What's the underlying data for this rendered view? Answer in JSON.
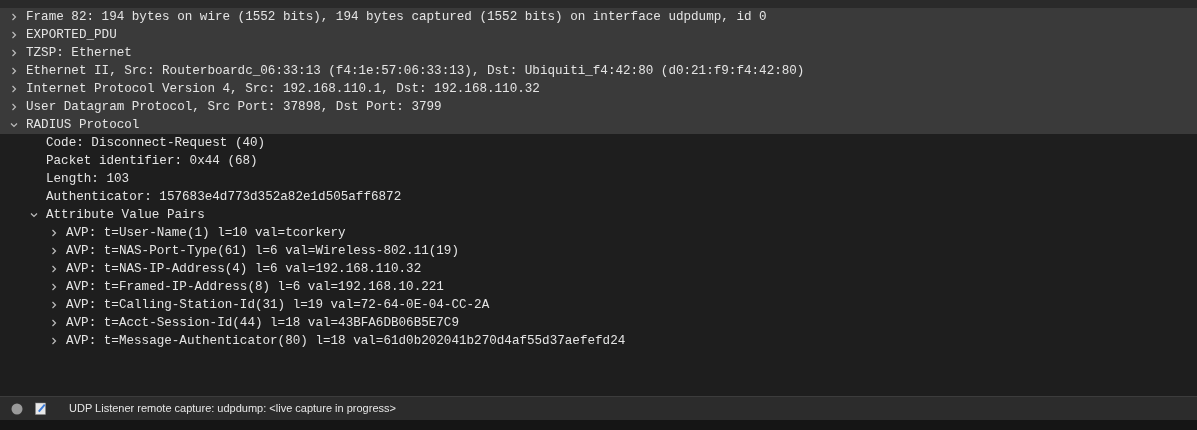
{
  "tree": [
    {
      "text": "Frame 82: 194 bytes on wire (1552 bits), 194 bytes captured (1552 bits) on interface udpdump, id 0",
      "expanded": false
    },
    {
      "text": "EXPORTED_PDU",
      "expanded": false
    },
    {
      "text": "TZSP: Ethernet",
      "expanded": false
    },
    {
      "text": "Ethernet II, Src: Routerboardc_06:33:13 (f4:1e:57:06:33:13), Dst: Ubiquiti_f4:42:80 (d0:21:f9:f4:42:80)",
      "expanded": false
    },
    {
      "text": "Internet Protocol Version 4, Src: 192.168.110.1, Dst: 192.168.110.32",
      "expanded": false
    },
    {
      "text": "User Datagram Protocol, Src Port: 37898, Dst Port: 3799",
      "expanded": false
    },
    {
      "text": "RADIUS Protocol",
      "expanded": true,
      "children": [
        {
          "text": "Code: Disconnect-Request (40)"
        },
        {
          "text": "Packet identifier: 0x44 (68)"
        },
        {
          "text": "Length: 103"
        },
        {
          "text": "Authenticator: 157683e4d773d352a82e1d505aff6872"
        },
        {
          "text": "Attribute Value Pairs",
          "expanded": true,
          "children": [
            {
              "text": "AVP: t=User-Name(1) l=10 val=tcorkery",
              "expanded": false
            },
            {
              "text": "AVP: t=NAS-Port-Type(61) l=6 val=Wireless-802.11(19)",
              "expanded": false
            },
            {
              "text": "AVP: t=NAS-IP-Address(4) l=6 val=192.168.110.32",
              "expanded": false
            },
            {
              "text": "AVP: t=Framed-IP-Address(8) l=6 val=192.168.10.221",
              "expanded": false
            },
            {
              "text": "AVP: t=Calling-Station-Id(31) l=19 val=72-64-0E-04-CC-2A",
              "expanded": false
            },
            {
              "text": "AVP: t=Acct-Session-Id(44) l=18 val=43BFA6DB06B5E7C9",
              "expanded": false
            },
            {
              "text": "AVP: t=Message-Authenticator(80) l=18 val=61d0b202041b270d4af55d37aefefd24",
              "expanded": false
            }
          ]
        }
      ]
    }
  ],
  "status_bar": {
    "text": "UDP Listener remote capture: udpdump: <live capture in progress>"
  }
}
